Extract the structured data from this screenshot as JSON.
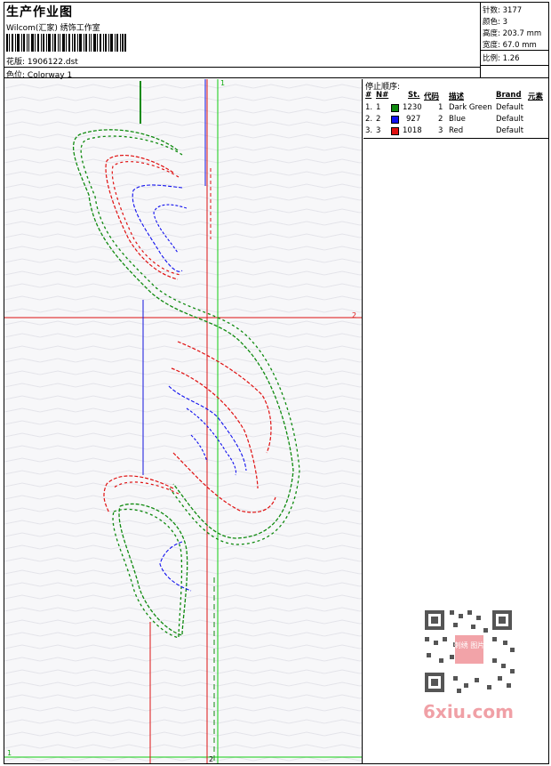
{
  "header": {
    "title": "生产作业图",
    "company": "Wilcom(汇家) 绣饰工作室",
    "file_label": "花版:",
    "file_name": "1906122.dst",
    "colorway_label": "色位:",
    "colorway_name": "Colorway 1"
  },
  "stats": [
    {
      "label": "针数:",
      "value": "3177"
    },
    {
      "label": "颜色:",
      "value": "3"
    },
    {
      "label": "高度:",
      "value": "203.7 mm"
    },
    {
      "label": "宽度:",
      "value": "67.0 mm"
    },
    {
      "label": "比例:",
      "value": "1.26"
    }
  ],
  "sequence": {
    "title": "停止顺序:",
    "columns": [
      "#",
      "N#",
      "St.",
      "代码",
      "描述",
      "Brand",
      "元素"
    ],
    "rows": [
      {
        "index": "1.",
        "n": "1",
        "stitches": "1230",
        "code": "1",
        "description": "Dark Green",
        "brand": "Default",
        "color": "#0f8a0f"
      },
      {
        "index": "2.",
        "n": "2",
        "stitches": "927",
        "code": "2",
        "description": "Blue",
        "brand": "Default",
        "color": "#1010ee"
      },
      {
        "index": "3.",
        "n": "3",
        "stitches": "1018",
        "code": "3",
        "description": "Red",
        "brand": "Default",
        "color": "#e01010"
      }
    ]
  },
  "canvas": {
    "marker_top_right": "1",
    "marker_mid_right": "2",
    "marker_bottom_left": "1",
    "marker_bottom_mid": "2",
    "line_colors": {
      "green": "#11cc11",
      "red": "#dd1111",
      "blue": "#1111dd"
    }
  },
  "watermark": {
    "text": "6xiu.com",
    "stamp": "刺绣 图片"
  }
}
